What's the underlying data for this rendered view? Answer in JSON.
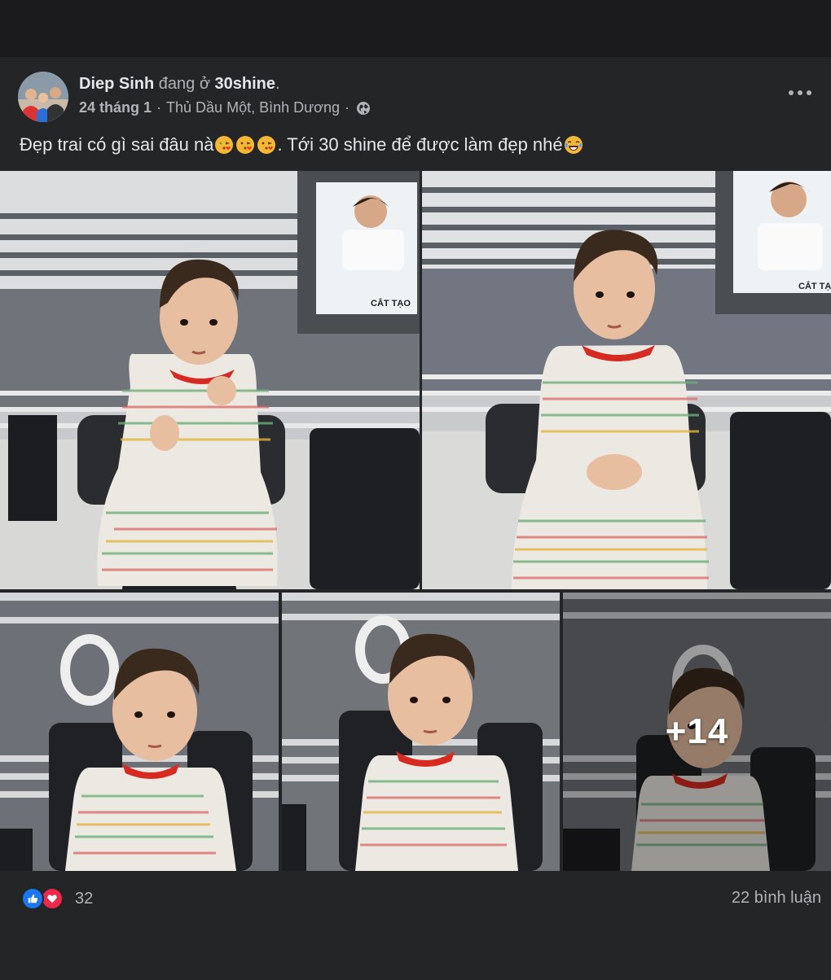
{
  "post": {
    "author": "Diep Sinh",
    "action": "đang ở",
    "place": "30shine",
    "date": "24 tháng 1",
    "location": "Thủ Dầu Một, Bình Dương",
    "privacy_icon": "globe-icon",
    "text_part1": "Đẹp trai có gì sai đâu nà ",
    "text_part2": ". Tới 30 shine để được làm đẹp nhé ",
    "emoji_kiss": "face-blowing-kiss-emoji",
    "emoji_laugh": "face-with-tears-of-joy-emoji"
  },
  "photos": {
    "count": 5,
    "more_overlay": "+14"
  },
  "footer": {
    "reaction_icons": [
      "like-icon",
      "love-icon"
    ],
    "reaction_count": "32",
    "comments": "22 bình luận"
  },
  "colors": {
    "background": "#242526",
    "text": "#e4e6eb",
    "secondary_text": "#b0b3b8",
    "like": "#1877f2",
    "love": "#f02849"
  }
}
